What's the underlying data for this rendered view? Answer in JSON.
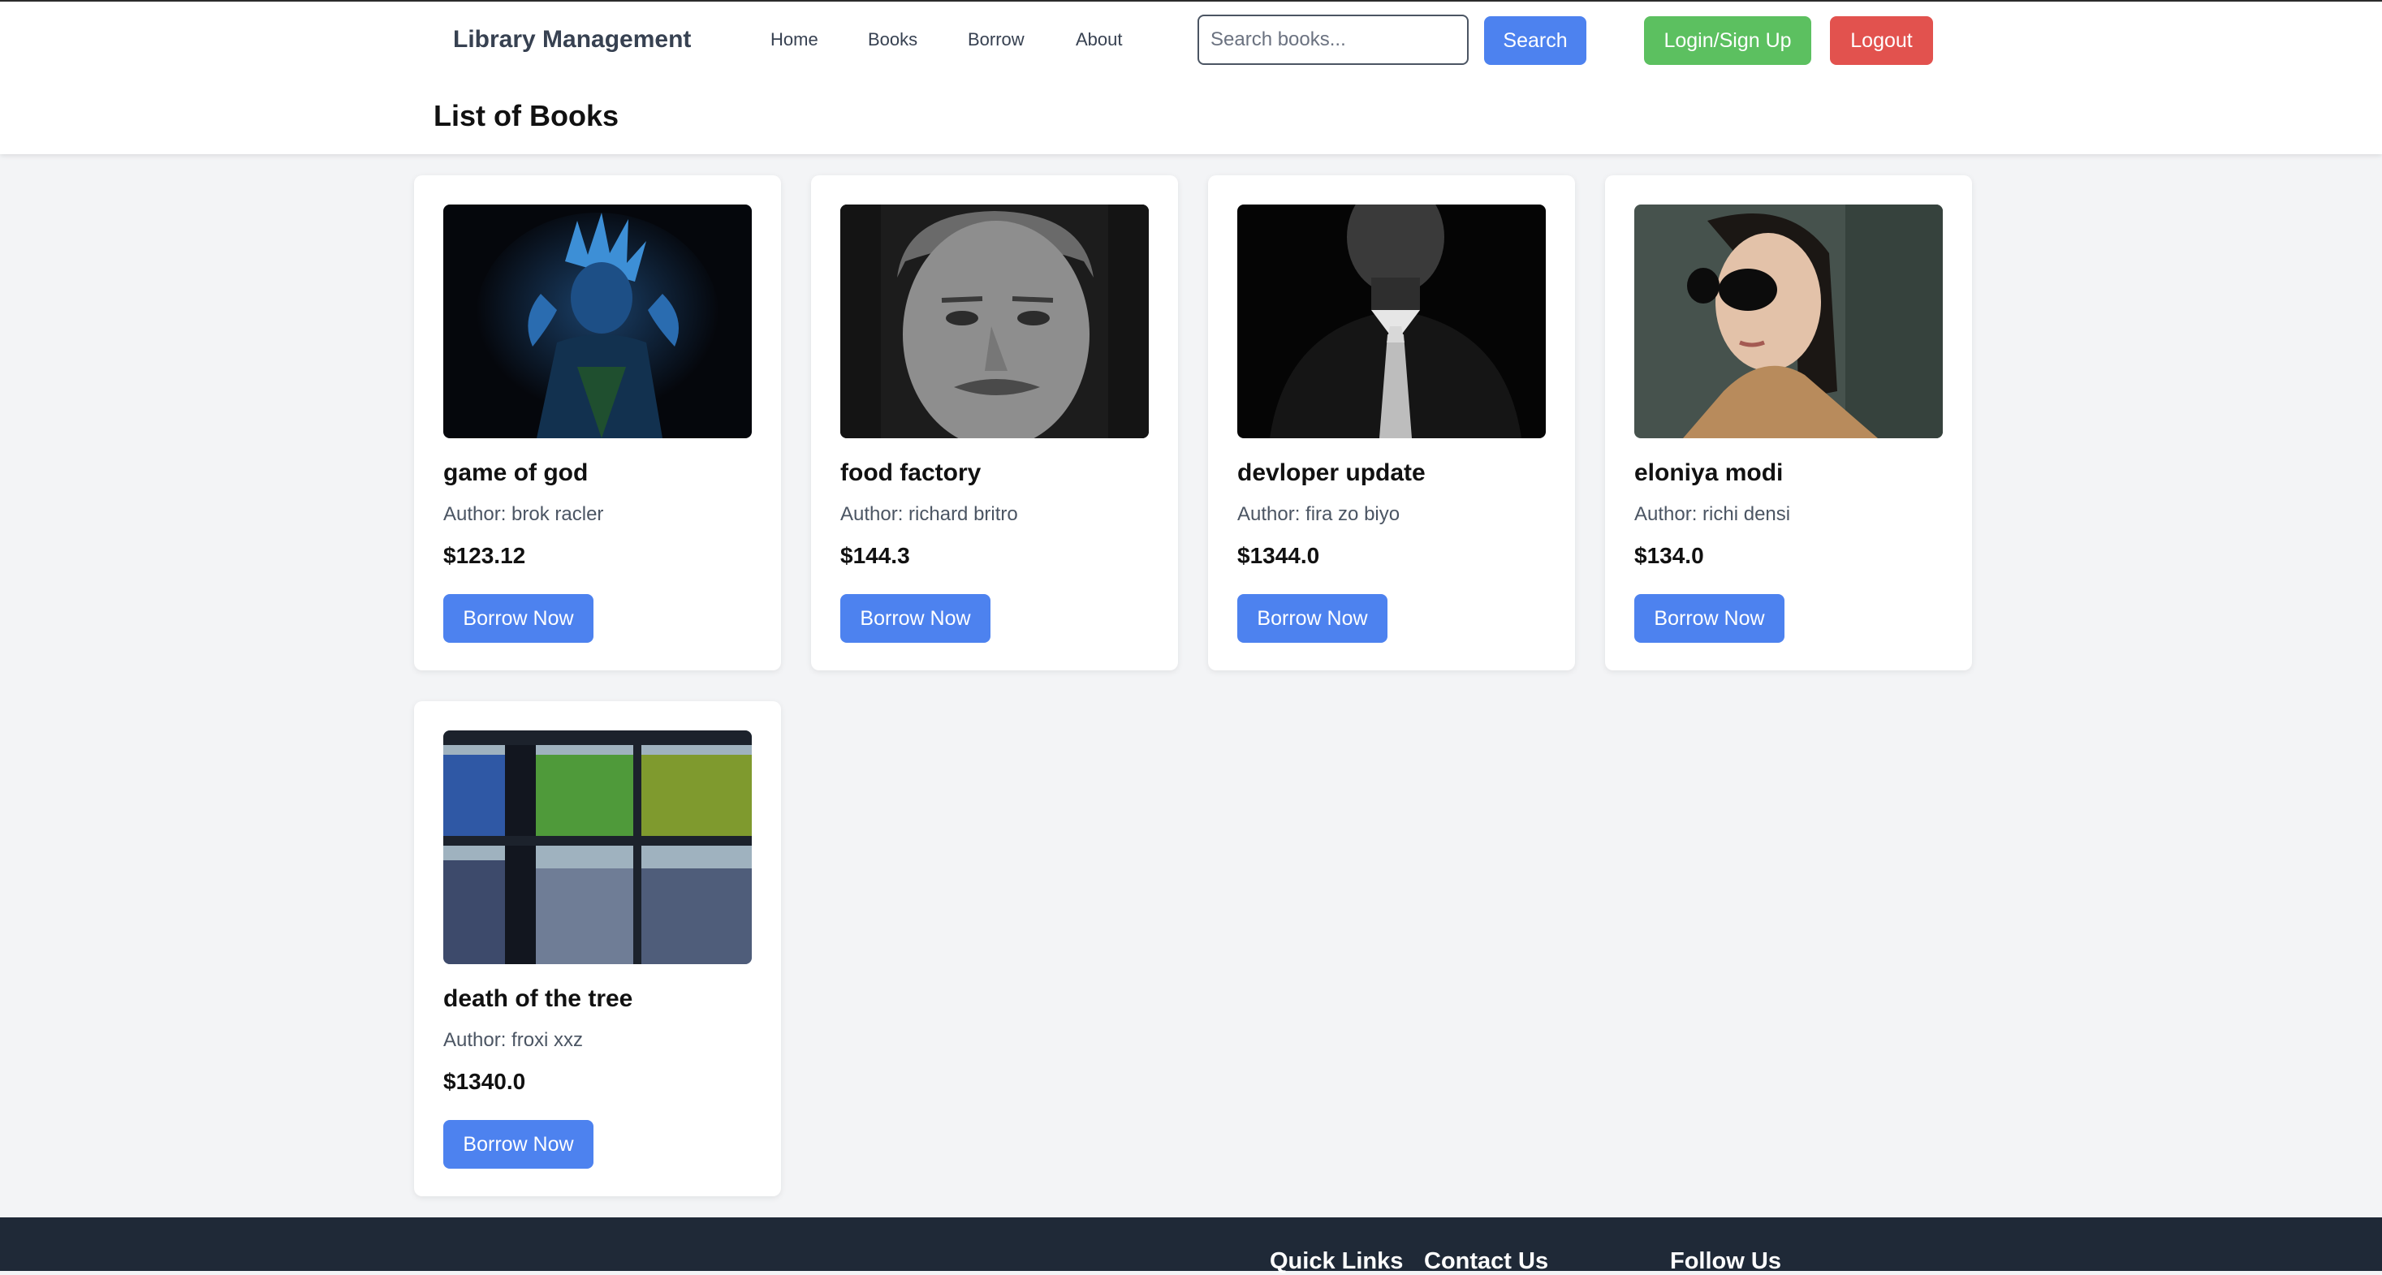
{
  "header": {
    "brand": "Library Management",
    "nav": [
      {
        "label": "Home"
      },
      {
        "label": "Books"
      },
      {
        "label": "Borrow"
      },
      {
        "label": "About"
      }
    ],
    "search": {
      "placeholder": "Search books...",
      "value": "",
      "button_label": "Search"
    },
    "login_label": "Login/Sign Up",
    "logout_label": "Logout"
  },
  "main": {
    "title": "List of Books",
    "books": [
      {
        "title": "game of god",
        "author": "Author: brok racler",
        "price": "$123.12",
        "button_label": "Borrow Now",
        "image": "anime-character-art"
      },
      {
        "title": "food factory",
        "author": "Author: richard britro",
        "price": "$144.3",
        "button_label": "Borrow Now",
        "image": "portrait-older-man-bw"
      },
      {
        "title": "devloper update",
        "author": "Author: fira zo biyo",
        "price": "$1344.0",
        "button_label": "Borrow Now",
        "image": "portrait-man-suit-bw"
      },
      {
        "title": "eloniya modi",
        "author": "Author: richi densi",
        "price": "$134.0",
        "button_label": "Borrow Now",
        "image": "portrait-woman-sunglasses"
      },
      {
        "title": "death of the tree",
        "author": "Author: froxi xxz",
        "price": "$1340.0",
        "button_label": "Borrow Now",
        "image": "bookshelf-binders"
      }
    ]
  },
  "footer": {
    "headings": [
      "Quick Links",
      "Contact Us",
      "Follow Us"
    ]
  },
  "colors": {
    "primary": "#4d82ef",
    "success": "#5cc060",
    "danger": "#e2524e",
    "footer_bg": "#1f2937",
    "page_bg": "#f3f4f6"
  }
}
